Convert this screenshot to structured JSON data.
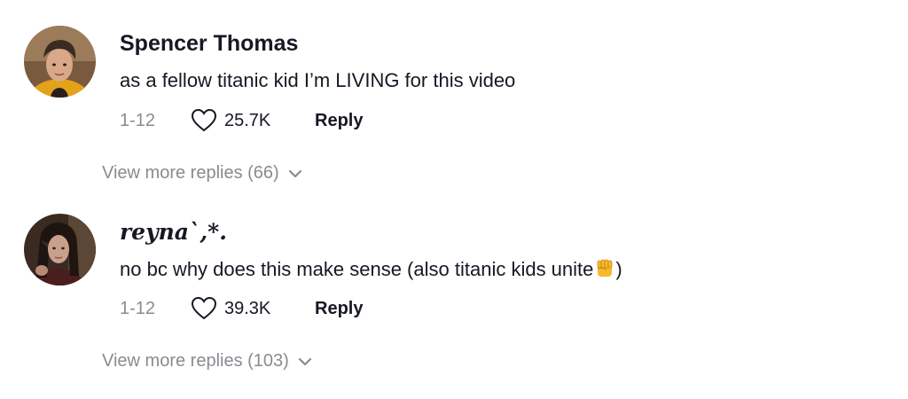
{
  "comments": [
    {
      "username": "Spencer Thomas",
      "text": "as a fellow titanic kid I’m LIVING for this video",
      "emoji": "",
      "date": "1-12",
      "likes": "25.7K",
      "reply_label": "Reply",
      "view_more": "View more replies (66)"
    },
    {
      "username": "reyna`,*.",
      "text": "no bc why does this make sense (also titanic kids unite",
      "emoji": "raised-fist",
      "text_after": ")",
      "date": "1-12",
      "likes": "39.3K",
      "reply_label": "Reply",
      "view_more": "View more replies (103)"
    }
  ],
  "colors": {
    "text_primary": "#161823",
    "text_secondary": "#8a8b91",
    "emoji_yellow": "#f5b82e"
  }
}
